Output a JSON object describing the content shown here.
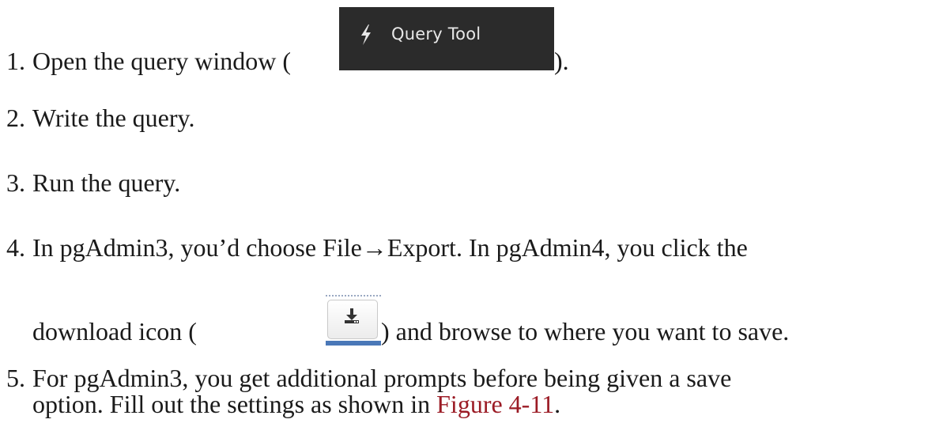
{
  "steps": [
    {
      "number": "1.",
      "text_before": "Open the query window (",
      "text_after": ")."
    },
    {
      "number": "2.",
      "text": "Write the query."
    },
    {
      "number": "3.",
      "text": "Run the query."
    },
    {
      "number": "4.",
      "line1": "In pgAdmin3, you’d choose File→Export. In pgAdmin4, you click the",
      "line2_before": "download icon (",
      "line2_after": ") and browse to where you want to save."
    },
    {
      "number": "5.",
      "line1": "For pgAdmin3, you get additional prompts before being given a save",
      "line2_before": "option. Fill out the settings as shown in ",
      "line2_link": "Figure 4-11",
      "line2_after": "."
    }
  ],
  "query_tool_button": {
    "label": "Query Tool",
    "icon": "lightning-bolt-icon",
    "background": "#2b2b2b",
    "text_color": "#e8e8e8"
  },
  "download_button": {
    "icon": "download-icon",
    "accent": "#4a78b8"
  },
  "colors": {
    "text": "#1a1a1a",
    "link": "#9b1b25"
  }
}
